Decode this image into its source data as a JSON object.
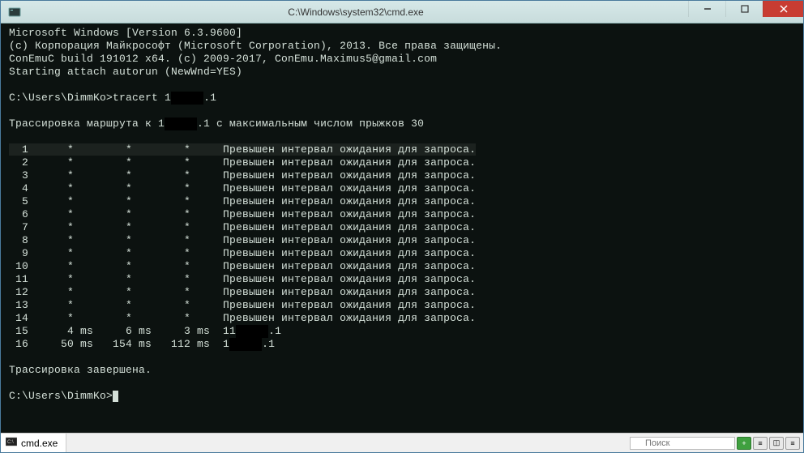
{
  "window": {
    "title": "C:\\Windows\\system32\\cmd.exe"
  },
  "terminal": {
    "header": {
      "line1": "Microsoft Windows [Version 6.3.9600]",
      "line2": "(c) Корпорация Майкрософт (Microsoft Corporation), 2013. Все права защищены.",
      "line3": "ConEmuC build 191012 x64. (c) 2009-2017, ConEmu.Maximus5@gmail.com",
      "line4": "Starting attach autorun (NewWnd=YES)"
    },
    "prompt1": {
      "prefix": "C:\\Users\\DimmKo>",
      "cmd_pre": "tracert 1",
      "cmd_post": ".1"
    },
    "trace_header": {
      "pre": "Трассировка маршрута к 1",
      "post": ".1 с максимальным числом прыжков 30"
    },
    "hops_timeout": [
      {
        "n": "  1",
        "c1": "    *   ",
        "c2": "    *   ",
        "c3": "    *   ",
        "msg": " Превышен интервал ожидания для запроса."
      },
      {
        "n": "  2",
        "c1": "    *   ",
        "c2": "    *   ",
        "c3": "    *   ",
        "msg": " Превышен интервал ожидания для запроса."
      },
      {
        "n": "  3",
        "c1": "    *   ",
        "c2": "    *   ",
        "c3": "    *   ",
        "msg": " Превышен интервал ожидания для запроса."
      },
      {
        "n": "  4",
        "c1": "    *   ",
        "c2": "    *   ",
        "c3": "    *   ",
        "msg": " Превышен интервал ожидания для запроса."
      },
      {
        "n": "  5",
        "c1": "    *   ",
        "c2": "    *   ",
        "c3": "    *   ",
        "msg": " Превышен интервал ожидания для запроса."
      },
      {
        "n": "  6",
        "c1": "    *   ",
        "c2": "    *   ",
        "c3": "    *   ",
        "msg": " Превышен интервал ожидания для запроса."
      },
      {
        "n": "  7",
        "c1": "    *   ",
        "c2": "    *   ",
        "c3": "    *   ",
        "msg": " Превышен интервал ожидания для запроса."
      },
      {
        "n": "  8",
        "c1": "    *   ",
        "c2": "    *   ",
        "c3": "    *   ",
        "msg": " Превышен интервал ожидания для запроса."
      },
      {
        "n": "  9",
        "c1": "    *   ",
        "c2": "    *   ",
        "c3": "    *   ",
        "msg": " Превышен интервал ожидания для запроса."
      },
      {
        "n": " 10",
        "c1": "    *   ",
        "c2": "    *   ",
        "c3": "    *   ",
        "msg": " Превышен интервал ожидания для запроса."
      },
      {
        "n": " 11",
        "c1": "    *   ",
        "c2": "    *   ",
        "c3": "    *   ",
        "msg": " Превышен интервал ожидания для запроса."
      },
      {
        "n": " 12",
        "c1": "    *   ",
        "c2": "    *   ",
        "c3": "    *   ",
        "msg": " Превышен интервал ожидания для запроса."
      },
      {
        "n": " 13",
        "c1": "    *   ",
        "c2": "    *   ",
        "c3": "    *   ",
        "msg": " Превышен интервал ожидания для запроса."
      },
      {
        "n": " 14",
        "c1": "    *   ",
        "c2": "    *   ",
        "c3": "    *   ",
        "msg": " Превышен интервал ожидания для запроса."
      }
    ],
    "hops_reply": [
      {
        "n": " 15",
        "c1": "    4 ms",
        "c2": "    6 ms",
        "c3": "    3 ms",
        "ip_pre": "  11",
        "ip_post": ".1"
      },
      {
        "n": " 16",
        "c1": "   50 ms",
        "c2": "  154 ms",
        "c3": "  112 ms",
        "ip_pre": "  1",
        "ip_post": ".1"
      }
    ],
    "footer": "Трассировка завершена.",
    "prompt2": "C:\\Users\\DimmKo>"
  },
  "tabbar": {
    "tab1": "cmd.exe",
    "search_placeholder": "Поиск",
    "btn_plus": "+",
    "btn_list": "≡",
    "btn_split": "◫",
    "btn_menu": "≡"
  }
}
